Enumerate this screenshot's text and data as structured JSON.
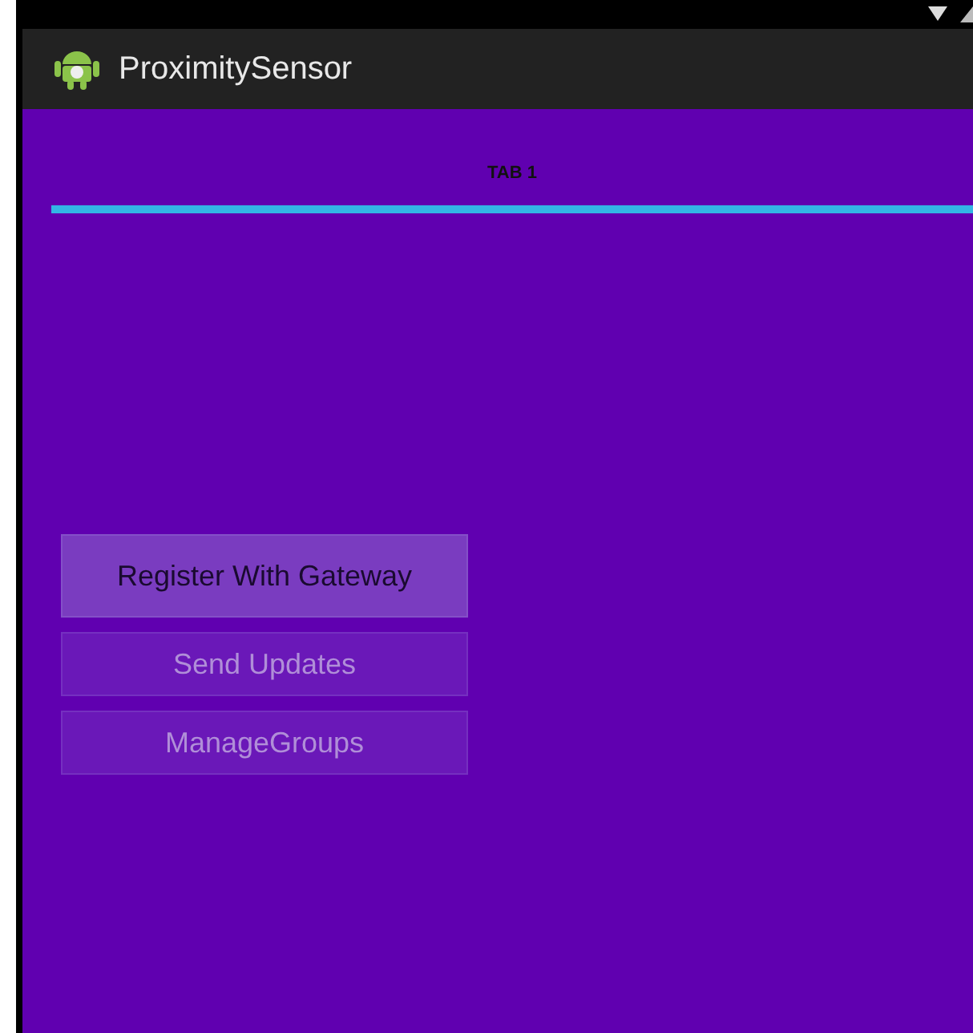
{
  "app_bar": {
    "title": "ProximitySensor"
  },
  "tabs": [
    {
      "label": "TAB 1",
      "selected": true
    }
  ],
  "buttons": [
    {
      "label": "Register With Gateway",
      "disabled": false
    },
    {
      "label": "Send Updates",
      "disabled": true
    },
    {
      "label": "ManageGroups",
      "disabled": true
    }
  ]
}
